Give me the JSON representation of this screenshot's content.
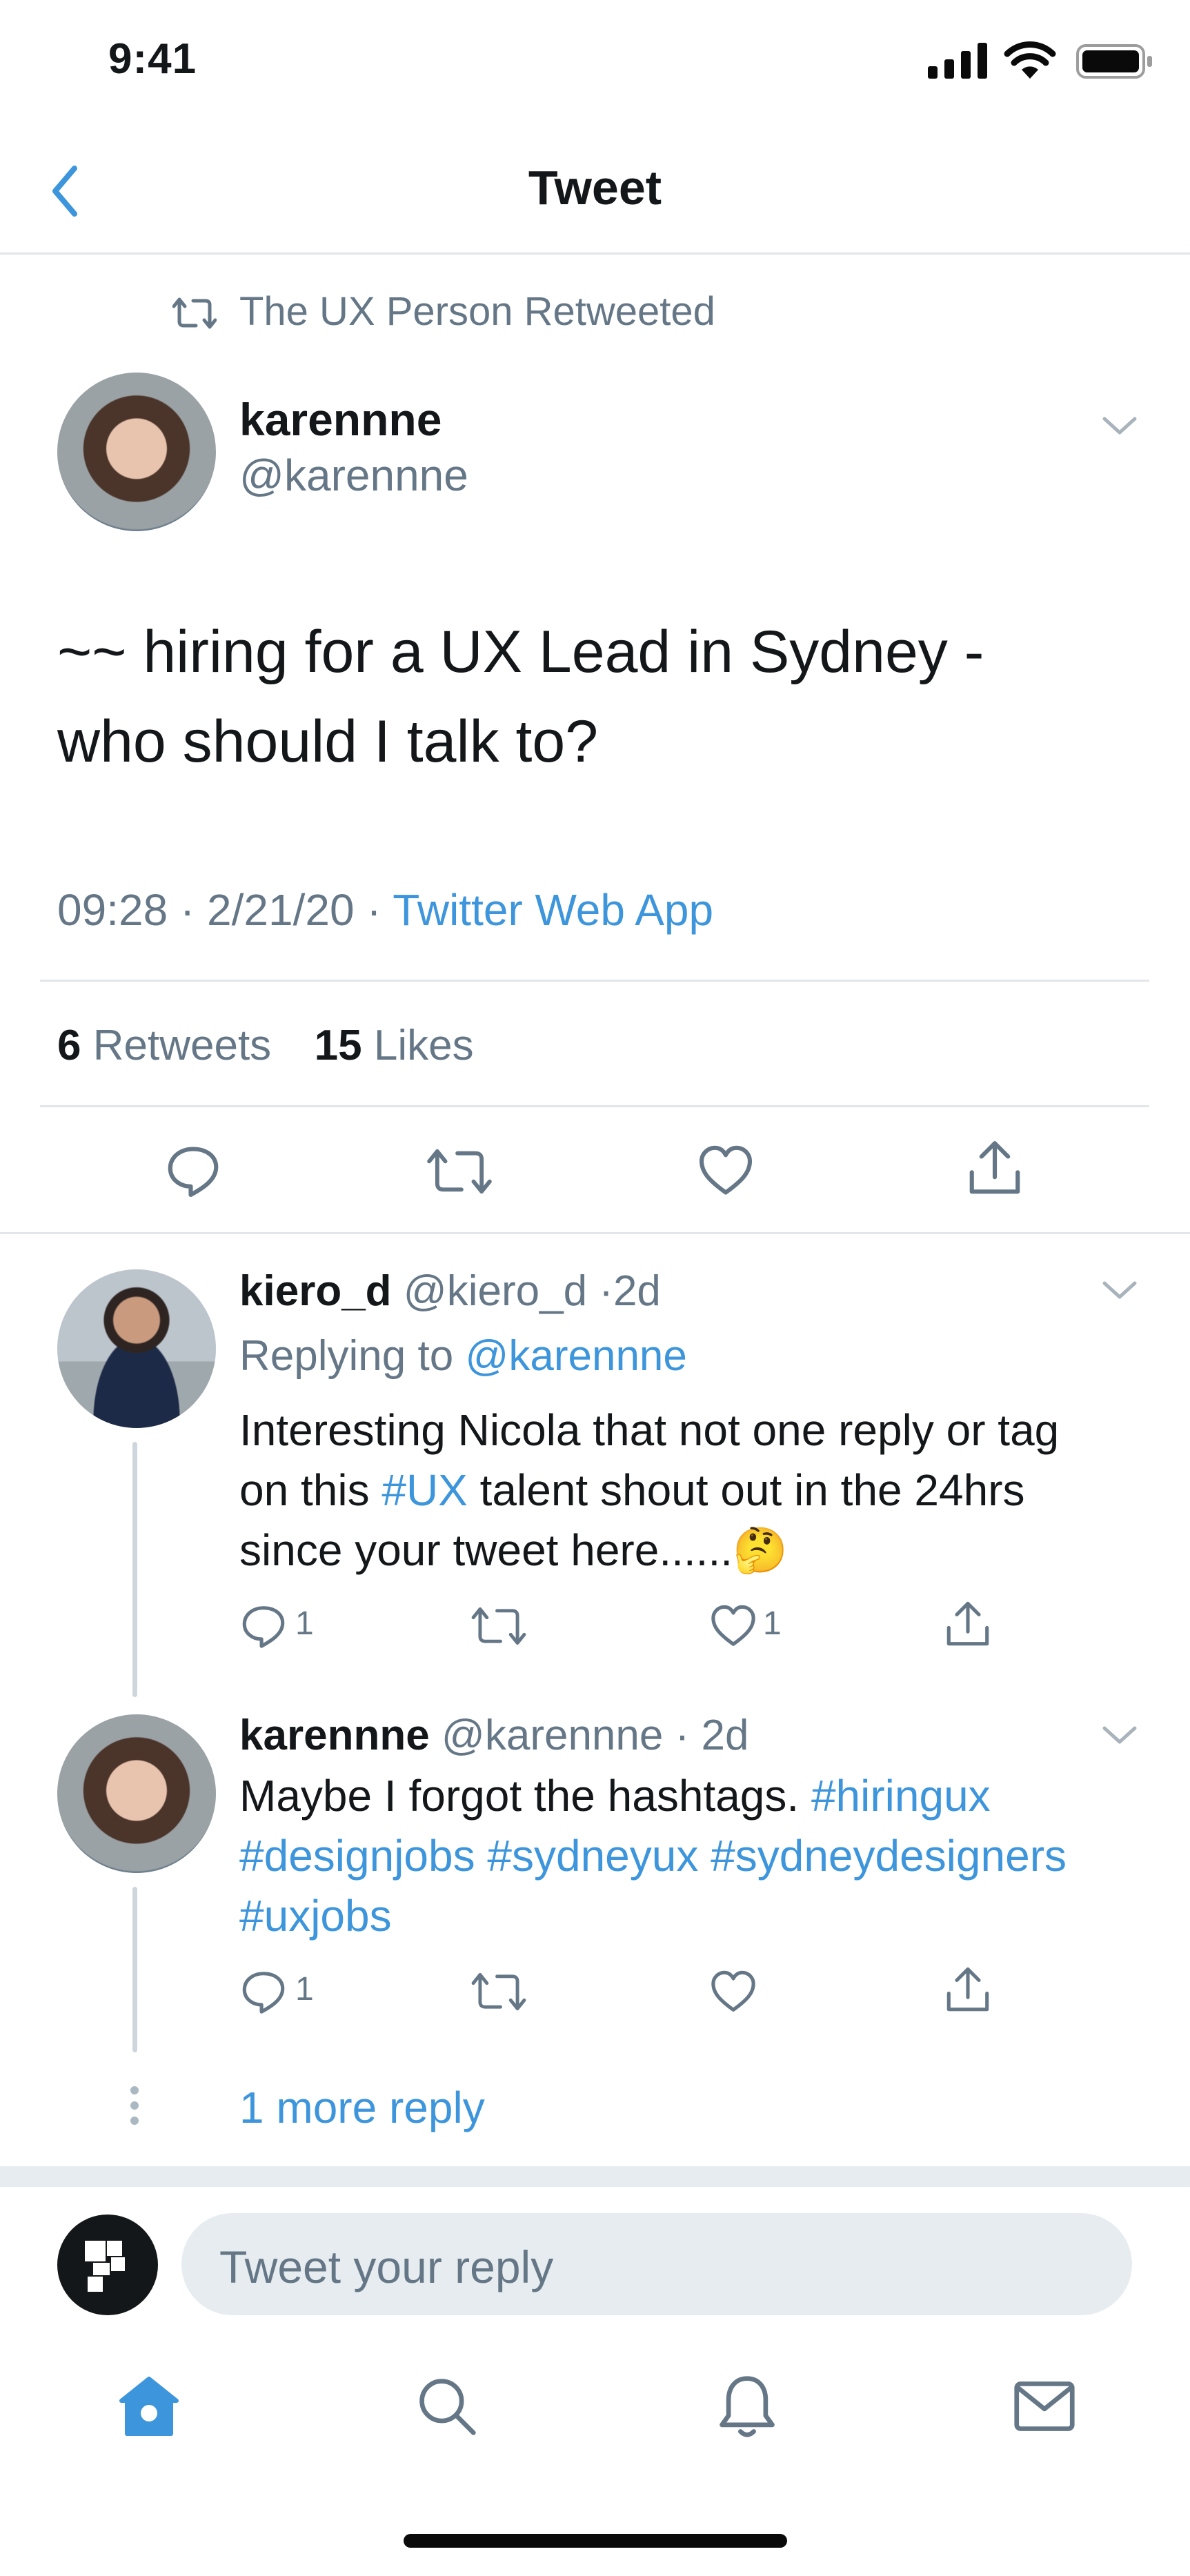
{
  "status_bar": {
    "time": "9:41"
  },
  "header": {
    "title": "Tweet"
  },
  "context": {
    "retweeted_by": "The UX Person Retweeted"
  },
  "tweet": {
    "display_name": "karennne",
    "handle": "@karennne",
    "text_line1": "~~ hiring for a UX Lead in Sydney -",
    "text_line2": "who should I talk to?",
    "time": "09:28 · 2/21/20 ·",
    "source": "Twitter Web App",
    "retweets_count": "6",
    "retweets_label": "Retweets",
    "likes_count": "15",
    "likes_label": "Likes"
  },
  "replies": [
    {
      "display_name": "kiero_d",
      "handle_time": "@kiero_d ·2d",
      "replying_prefix": "Replying to",
      "replying_to": "@karennne",
      "line1": "Interesting Nicola that not one reply or tag",
      "line2_a": "on this",
      "line2_hashtag": "#UX",
      "line2_b": "talent shout out in the 24hrs",
      "line3": "since your tweet here......",
      "line3_emoji": "🤔",
      "reply_count": "1",
      "like_count": "1"
    },
    {
      "display_name": "karennne",
      "handle_time": "@karennne · 2d",
      "line1_text": "Maybe I forgot the hashtags.",
      "line1_hashtag": "#hiringux",
      "line2": "#designjobs #sydneyux #sydneydesigners",
      "line3": "#uxjobs",
      "reply_count": "1"
    }
  ],
  "more_replies": "1 more reply",
  "composer": {
    "placeholder": "Tweet your reply"
  },
  "tab_bar": [
    "home-icon",
    "search-icon",
    "notifications-icon",
    "messages-icon"
  ],
  "colors": {
    "accent": "#3d95dc",
    "muted": "#657786",
    "text": "#14171a",
    "divider": "#e3e6e9"
  }
}
